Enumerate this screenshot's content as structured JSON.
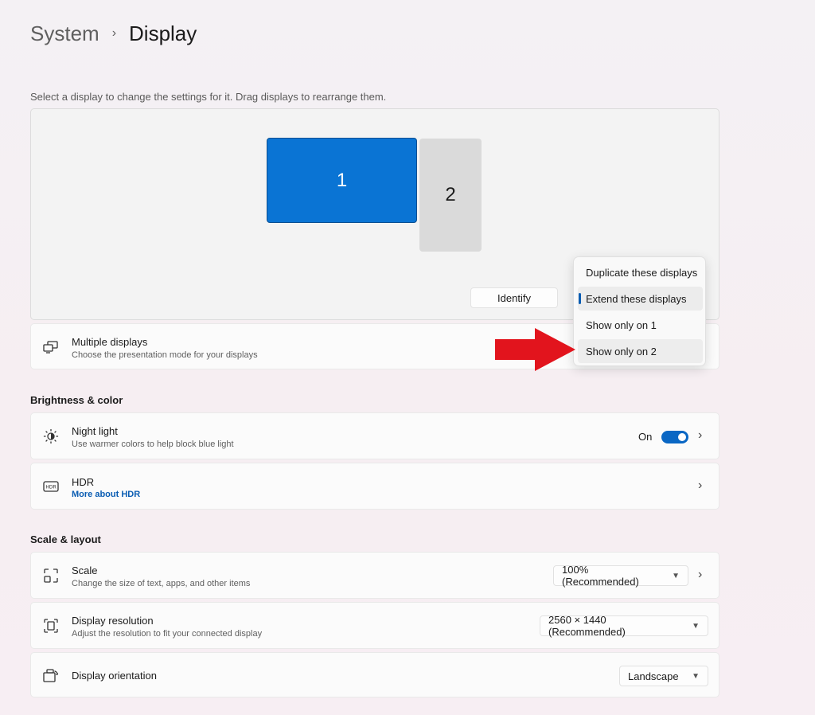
{
  "breadcrumb": {
    "parent": "System",
    "separator": "›",
    "current": "Display"
  },
  "hint": "Select a display to change the settings for it. Drag displays to rearrange them.",
  "arrangement": {
    "monitor_1": "1",
    "monitor_2": "2",
    "identify_label": "Identify",
    "selected_color": "#0a74d4"
  },
  "multiple_displays": {
    "title": "Multiple displays",
    "subtitle": "Choose the presentation mode for your displays",
    "icon": "multiple-displays-icon"
  },
  "presentation_menu": {
    "items": [
      {
        "label": "Duplicate these displays"
      },
      {
        "label": "Extend these displays"
      },
      {
        "label": "Show only on 1"
      },
      {
        "label": "Show only on 2"
      }
    ],
    "selected": "Extend these displays",
    "hovered": "Show only on 2"
  },
  "brightness_color": {
    "heading": "Brightness & color",
    "night_light": {
      "title": "Night light",
      "subtitle": "Use warmer colors to help block blue light",
      "state_label": "On",
      "enabled": true,
      "icon": "night-light-icon"
    },
    "hdr": {
      "title": "HDR",
      "link": "More about HDR",
      "icon": "hdr-icon"
    }
  },
  "scale_layout": {
    "heading": "Scale & layout",
    "scale": {
      "title": "Scale",
      "subtitle": "Change the size of text, apps, and other items",
      "value": "100% (Recommended)",
      "icon": "scale-icon"
    },
    "resolution": {
      "title": "Display resolution",
      "subtitle": "Adjust the resolution to fit your connected display",
      "value": "2560 × 1440 (Recommended)",
      "icon": "resolution-icon"
    },
    "orientation": {
      "title": "Display orientation",
      "value": "Landscape",
      "icon": "orientation-icon"
    }
  },
  "colors": {
    "accent": "#0a67c4",
    "link": "#0a5db3",
    "arrow": "#e2141d"
  }
}
